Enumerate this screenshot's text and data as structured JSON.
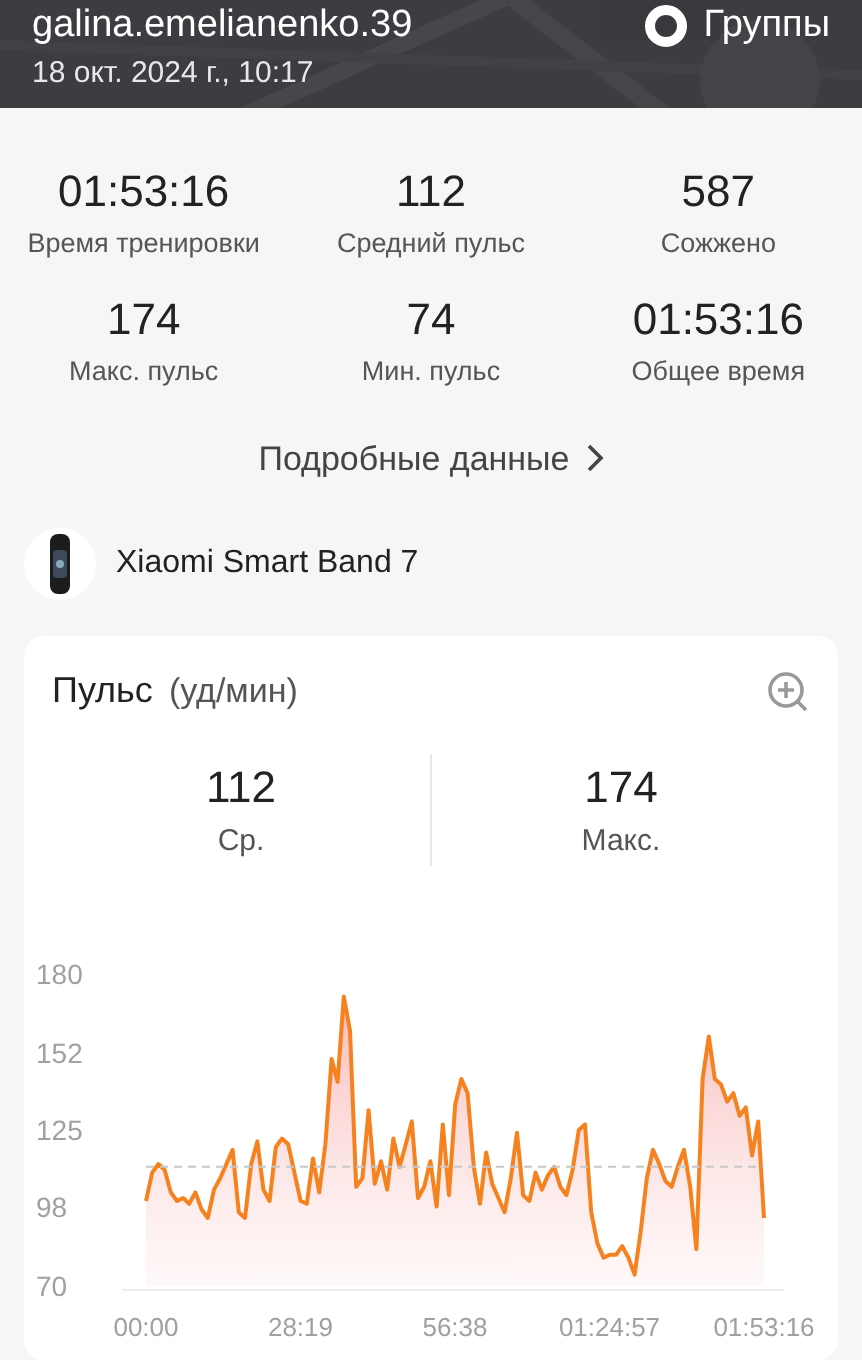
{
  "header": {
    "username": "galina.emelianenko.39",
    "date": "18 окт. 2024 г., 10:17",
    "groups_label": "Группы"
  },
  "stats": [
    {
      "value": "01:53:16",
      "label": "Время тренировки"
    },
    {
      "value": "112",
      "label": "Средний пульс"
    },
    {
      "value": "587",
      "label": "Сожжено"
    },
    {
      "value": "174",
      "label": "Макс. пульс"
    },
    {
      "value": "74",
      "label": "Мин. пульс"
    },
    {
      "value": "01:53:16",
      "label": "Общее время"
    }
  ],
  "details_link": "Подробные данные",
  "device": {
    "name": "Xiaomi Smart Band 7"
  },
  "heart_rate_card": {
    "title": "Пульс",
    "unit": "(уд/мин)",
    "summary": [
      {
        "value": "112",
        "label": "Ср."
      },
      {
        "value": "174",
        "label": "Макс."
      }
    ],
    "chart_data": {
      "type": "area",
      "ylim": [
        70,
        180
      ],
      "yticks": [
        70,
        98,
        125,
        152,
        180
      ],
      "xlim": [
        0,
        6796
      ],
      "x": [
        0,
        68,
        136,
        204,
        272,
        340,
        408,
        476,
        544,
        612,
        680,
        748,
        816,
        884,
        952,
        1020,
        1088,
        1156,
        1224,
        1292,
        1360,
        1428,
        1496,
        1564,
        1632,
        1700,
        1768,
        1836,
        1904,
        1972,
        2040,
        2108,
        2176,
        2244,
        2312,
        2380,
        2448,
        2516,
        2584,
        2652,
        2720,
        2788,
        2856,
        2924,
        2992,
        3060,
        3128,
        3196,
        3264,
        3332,
        3400,
        3468,
        3536,
        3604,
        3672,
        3740,
        3808,
        3876,
        3944,
        4012,
        4080,
        4148,
        4216,
        4284,
        4352,
        4420,
        4488,
        4556,
        4624,
        4692,
        4760,
        4828,
        4896,
        4964,
        5032,
        5100,
        5168,
        5236,
        5304,
        5372,
        5440,
        5508,
        5576,
        5644,
        5712,
        5780,
        5848,
        5916,
        5984,
        6052,
        6120,
        6188,
        6256,
        6324,
        6392,
        6460,
        6528,
        6596,
        6664,
        6732,
        6796
      ],
      "xticks": [
        {
          "value": 0,
          "label": "00:00"
        },
        {
          "value": 1699,
          "label": "28:19"
        },
        {
          "value": 3398,
          "label": "56:38"
        },
        {
          "value": 5097,
          "label": "01:24:57"
        },
        {
          "value": 6796,
          "label": "01:53:16"
        }
      ],
      "series": [
        {
          "color": "#f5821f",
          "values": [
            100,
            110,
            113,
            111,
            103,
            100,
            101,
            99,
            103,
            97,
            94,
            104,
            108,
            113,
            118,
            96,
            94,
            113,
            121,
            104,
            100,
            119,
            122,
            120,
            110,
            100,
            99,
            115,
            103,
            120,
            150,
            142,
            172,
            160,
            105,
            108,
            132,
            106,
            114,
            104,
            122,
            112,
            120,
            128,
            101,
            105,
            114,
            98,
            127,
            102,
            134,
            143,
            138,
            112,
            99,
            117,
            106,
            101,
            96,
            108,
            124,
            102,
            100,
            110,
            104,
            109,
            112,
            105,
            102,
            111,
            125,
            127,
            96,
            85,
            80,
            81,
            81,
            84,
            80,
            74,
            89,
            108,
            118,
            113,
            107,
            105,
            112,
            118,
            105,
            83,
            143,
            158,
            143,
            141,
            135,
            138,
            130,
            133,
            116,
            128,
            94
          ]
        }
      ]
    }
  }
}
